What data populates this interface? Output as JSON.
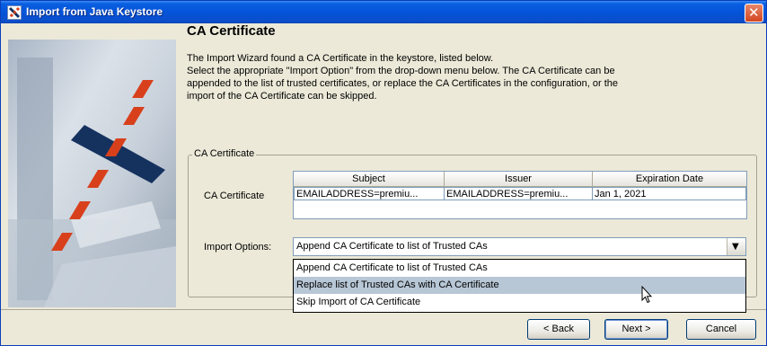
{
  "window": {
    "title": "Import from Java Keystore"
  },
  "page": {
    "heading": "CA Certificate",
    "description": [
      "The Import Wizard found a CA Certificate in the keystore, listed below.",
      "Select the appropriate \"Import Option\" from the drop-down menu below. The CA Certificate can be",
      "appended to the list of trusted certificates, or replace the CA Certificates in the configuration, or the",
      "import of the CA Certificate can be skipped."
    ]
  },
  "group": {
    "title": "CA Certificate",
    "ca_label": "CA Certificate",
    "table": {
      "columns": [
        "Subject",
        "Issuer",
        "Expiration Date"
      ],
      "rows": [
        [
          "EMAILADDRESS=premiu...",
          "EMAILADDRESS=premiu...",
          "Jan 1, 2021"
        ]
      ]
    },
    "import_label": "Import Options:",
    "import_selected": "Append CA Certificate to list of Trusted CAs",
    "options": [
      "Append CA Certificate to list of Trusted CAs",
      "Replace list of Trusted CAs with CA Certificate",
      "Skip Import of CA Certificate"
    ],
    "highlighted_index": 1
  },
  "buttons": {
    "back": "< Back",
    "next": "Next >",
    "cancel": "Cancel"
  },
  "icons": {
    "close": "close-icon",
    "app": "app-icon",
    "combo_arrow": "chevron-down-icon"
  },
  "colors": {
    "titlebar": "#0453d9",
    "highlight": "#b8c7d6",
    "accent_red": "#d8401c"
  }
}
